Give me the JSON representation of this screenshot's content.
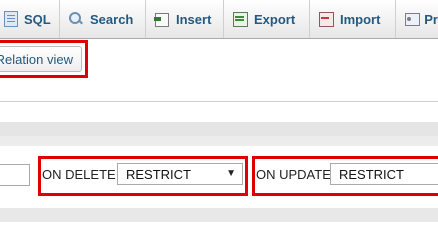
{
  "tabs": [
    {
      "label": "SQL",
      "icon": "sql-icon"
    },
    {
      "label": "Search",
      "icon": "search-icon"
    },
    {
      "label": "Insert",
      "icon": "insert-icon"
    },
    {
      "label": "Export",
      "icon": "export-icon"
    },
    {
      "label": "Import",
      "icon": "import-icon"
    },
    {
      "label": "Pr",
      "icon": "privileges-icon"
    }
  ],
  "relation_view_label": "Relation view",
  "constraints": {
    "on_delete_label": "ON DELETE",
    "on_delete_value": "RESTRICT",
    "on_update_label": "ON UPDATE",
    "on_update_value": "RESTRICT"
  },
  "highlight_color": "#e00000",
  "link_color": "#235a81"
}
